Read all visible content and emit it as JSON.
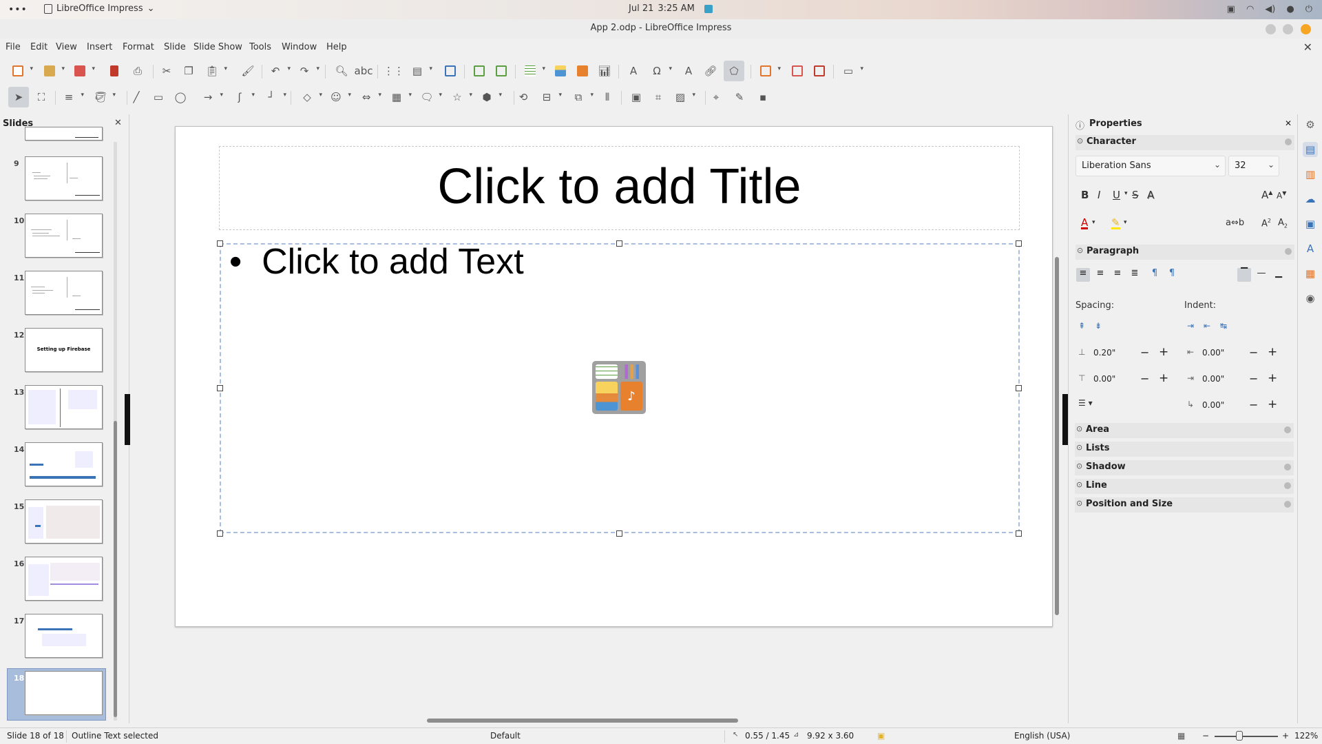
{
  "system_bar": {
    "app_name": "LibreOffice Impress",
    "date": "Jul 21",
    "time": "3:25 AM"
  },
  "window": {
    "title": "App 2.odp - LibreOffice Impress"
  },
  "menu": [
    "File",
    "Edit",
    "View",
    "Insert",
    "Format",
    "Slide",
    "Slide Show",
    "Tools",
    "Window",
    "Help"
  ],
  "slides_pane": {
    "header": "Slides",
    "slides": [
      {
        "num": "9",
        "kind": "text-doc"
      },
      {
        "num": "10",
        "kind": "text-doc"
      },
      {
        "num": "11",
        "kind": "text-doc"
      },
      {
        "num": "12",
        "kind": "title",
        "title": "Setting up Firebase"
      },
      {
        "num": "13",
        "kind": "screenshot"
      },
      {
        "num": "14",
        "kind": "screenshot"
      },
      {
        "num": "15",
        "kind": "screenshot"
      },
      {
        "num": "16",
        "kind": "screenshot"
      },
      {
        "num": "17",
        "kind": "screenshot"
      },
      {
        "num": "18",
        "kind": "blank",
        "selected": true
      }
    ]
  },
  "slide": {
    "title_placeholder": "Click to add Title",
    "content_placeholder": "Click to add Text"
  },
  "properties": {
    "title": "Properties",
    "character": {
      "header": "Character",
      "font_name": "Liberation Sans",
      "font_size": "32"
    },
    "paragraph": {
      "header": "Paragraph",
      "spacing_label": "Spacing:",
      "indent_label": "Indent:",
      "above_spacing": "0.20\"",
      "below_spacing": "0.00\"",
      "before_indent": "0.00\"",
      "after_indent": "0.00\"",
      "first_line_indent": "0.00\""
    },
    "collapsed_sections": [
      "Area",
      "Lists",
      "Shadow",
      "Line",
      "Position and Size"
    ]
  },
  "status": {
    "slide_info": "Slide 18 of 18",
    "selection": "Outline Text selected",
    "master": "Default",
    "position": "0.55 / 1.45",
    "size": "9.92 x 3.60",
    "language": "English (USA)",
    "zoom": "122%"
  },
  "colors": {
    "accent": "#3b73b9",
    "selection_border": "#a9bde0",
    "selected_slide_bg": "#a7bddb"
  }
}
